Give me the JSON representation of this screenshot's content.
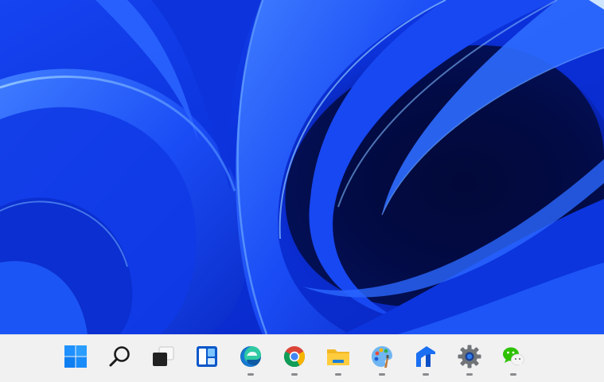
{
  "desktop": {
    "wallpaper": "windows-11-bloom-wallpaper",
    "colors": {
      "base": "#0a2fd8",
      "deep": "#030a4a",
      "light": "#3f7dff",
      "highlight": "#8cc8ff"
    }
  },
  "taskbar": {
    "background": "#f1f1f2",
    "items": [
      {
        "id": "start",
        "icon": "windows-logo-icon",
        "running": false
      },
      {
        "id": "search",
        "icon": "search-icon",
        "running": false
      },
      {
        "id": "task-view",
        "icon": "task-view-icon",
        "running": false
      },
      {
        "id": "widgets",
        "icon": "widgets-icon",
        "running": false
      },
      {
        "id": "edge",
        "icon": "edge-icon",
        "running": true
      },
      {
        "id": "chrome",
        "icon": "chrome-icon",
        "running": true
      },
      {
        "id": "file-explorer",
        "icon": "folder-icon",
        "running": true
      },
      {
        "id": "paint",
        "icon": "paint-palette-icon",
        "running": true
      },
      {
        "id": "app-arrow",
        "icon": "blue-arrow-app-icon",
        "running": true
      },
      {
        "id": "settings",
        "icon": "gear-icon",
        "running": true
      },
      {
        "id": "wechat",
        "icon": "wechat-icon",
        "running": true
      }
    ]
  }
}
